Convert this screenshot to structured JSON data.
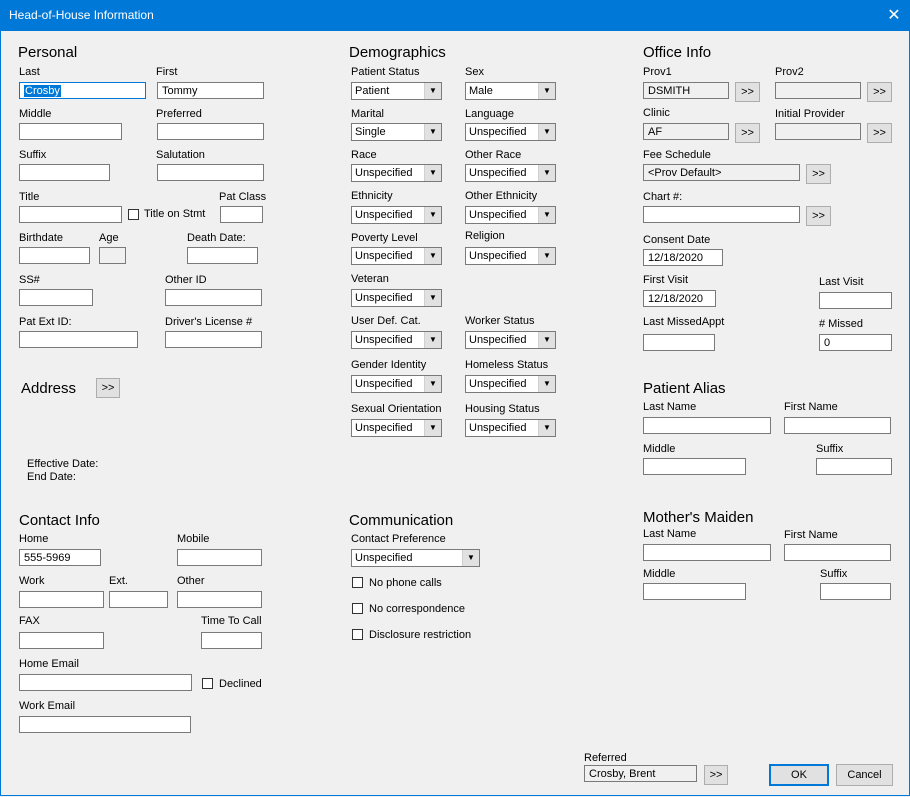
{
  "window": {
    "title": "Head-of-House Information",
    "close_glyph": "✕"
  },
  "personal": {
    "heading": "Personal",
    "last_label": "Last",
    "last_value": "Crosby",
    "first_label": "First",
    "first_value": "Tommy",
    "middle_label": "Middle",
    "middle_value": "",
    "preferred_label": "Preferred",
    "preferred_value": "",
    "suffix_label": "Suffix",
    "suffix_value": "",
    "salutation_label": "Salutation",
    "salutation_value": "",
    "title_label": "Title",
    "title_value": "",
    "title_on_stmt_label": "Title on Stmt",
    "pat_class_label": "Pat Class",
    "pat_class_value": "",
    "birthdate_label": "Birthdate",
    "birthdate_value": "",
    "age_label": "Age",
    "age_value": "",
    "death_date_label": "Death Date:",
    "death_date_value": "",
    "ssn_label": "SS#",
    "ssn_value": "",
    "other_id_label": "Other ID",
    "other_id_value": "",
    "pat_ext_id_label": "Pat Ext ID:",
    "pat_ext_id_value": "",
    "drivers_license_label": "Driver's License #",
    "drivers_license_value": ""
  },
  "address": {
    "heading": "Address",
    "button_label": ">>",
    "effective_date_label": "Effective Date:",
    "end_date_label": "End Date:"
  },
  "contact": {
    "heading": "Contact Info",
    "home_label": "Home",
    "home_value": "555-5969",
    "mobile_label": "Mobile",
    "mobile_value": "",
    "work_label": "Work",
    "work_value": "",
    "ext_label": "Ext.",
    "ext_value": "",
    "other_label": "Other",
    "other_value": "",
    "fax_label": "FAX",
    "fax_value": "",
    "time_to_call_label": "Time To Call",
    "time_to_call_value": "",
    "home_email_label": "Home Email",
    "home_email_value": "",
    "declined_label": "Declined",
    "work_email_label": "Work Email",
    "work_email_value": ""
  },
  "demographics": {
    "heading": "Demographics",
    "patient_status_label": "Patient Status",
    "patient_status_value": "Patient",
    "sex_label": "Sex",
    "sex_value": "Male",
    "marital_label": "Marital",
    "marital_value": "Single",
    "language_label": "Language",
    "language_value": "Unspecified",
    "race_label": "Race",
    "race_value": "Unspecified",
    "other_race_label": "Other Race",
    "other_race_value": "Unspecified",
    "ethnicity_label": "Ethnicity",
    "ethnicity_value": "Unspecified",
    "other_ethnicity_label": "Other Ethnicity",
    "other_ethnicity_value": "Unspecified",
    "poverty_level_label": "Poverty Level",
    "poverty_level_value": "Unspecified",
    "religion_label": "Religion",
    "religion_value": "Unspecified",
    "veteran_label": "Veteran",
    "veteran_value": "Unspecified",
    "user_def_cat_label": "User Def. Cat.",
    "user_def_cat_value": "Unspecified",
    "worker_status_label": "Worker Status",
    "worker_status_value": "Unspecified",
    "gender_identity_label": "Gender Identity",
    "gender_identity_value": "Unspecified",
    "homeless_status_label": "Homeless Status",
    "homeless_status_value": "Unspecified",
    "sexual_orientation_label": "Sexual Orientation",
    "sexual_orientation_value": "Unspecified",
    "housing_status_label": "Housing Status",
    "housing_status_value": "Unspecified"
  },
  "communication": {
    "heading": "Communication",
    "contact_preference_label": "Contact Preference",
    "contact_preference_value": "Unspecified",
    "no_phone_calls_label": "No phone calls",
    "no_correspondence_label": "No correspondence",
    "disclosure_restriction_label": "Disclosure restriction"
  },
  "office": {
    "heading": "Office Info",
    "prov1_label": "Prov1",
    "prov1_value": "DSMITH",
    "prov2_label": "Prov2",
    "prov2_value": "",
    "clinic_label": "Clinic",
    "clinic_value": "AF",
    "initial_provider_label": "Initial Provider",
    "initial_provider_value": "",
    "fee_schedule_label": "Fee Schedule",
    "fee_schedule_value": "<Prov Default>",
    "chart_label": "Chart #:",
    "chart_value": "",
    "consent_date_label": "Consent Date",
    "consent_date_value": "12/18/2020",
    "first_visit_label": "First Visit",
    "first_visit_value": "12/18/2020",
    "last_visit_label": "Last Visit",
    "last_visit_value": "",
    "last_missed_appt_label": "Last MissedAppt",
    "last_missed_appt_value": "",
    "missed_count_label": "# Missed",
    "missed_count_value": "0",
    "button_label": ">>"
  },
  "patient_alias": {
    "heading": "Patient Alias",
    "last_name_label": "Last Name",
    "last_name_value": "",
    "first_name_label": "First Name",
    "first_name_value": "",
    "middle_label": "Middle",
    "middle_value": "",
    "suffix_label": "Suffix",
    "suffix_value": ""
  },
  "mothers_maiden": {
    "heading": "Mother's Maiden",
    "last_name_label": "Last Name",
    "last_name_value": "",
    "first_name_label": "First Name",
    "first_name_value": "",
    "middle_label": "Middle",
    "middle_value": "",
    "suffix_label": "Suffix",
    "suffix_value": ""
  },
  "footer": {
    "referred_label": "Referred",
    "referred_value": "Crosby, Brent",
    "referred_button": ">>",
    "ok_label": "OK",
    "cancel_label": "Cancel"
  },
  "dropdown_arrow": "▼"
}
